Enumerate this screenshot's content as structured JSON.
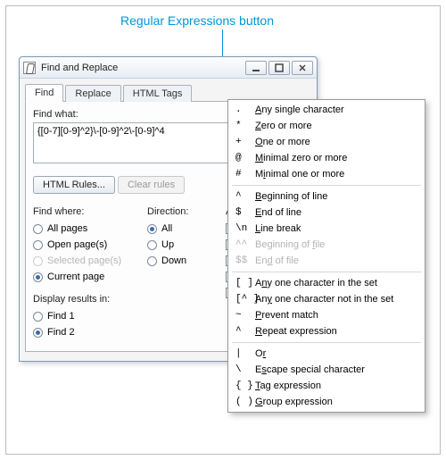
{
  "annotation": "Regular Expressions button",
  "window": {
    "title": "Find and Replace",
    "tabs": [
      "Find",
      "Replace",
      "HTML Tags"
    ],
    "find_label": "Find what:",
    "find_value": "{[0-7][0-9]^2}\\-[0-9]^2\\-[0-9]^4",
    "html_rules_btn": "HTML Rules...",
    "clear_rules_btn": "Clear rules",
    "find_where_label": "Find where:",
    "find_where": {
      "all_pages": "All pages",
      "open_pages": "Open page(s)",
      "selected_pages": "Selected page(s)",
      "current_page": "Current page"
    },
    "direction_label": "Direction:",
    "direction": {
      "all": "All",
      "up": "Up",
      "down": "Down"
    },
    "advanced_label": "Adv",
    "display_label": "Display results in:",
    "display": {
      "find1": "Find 1",
      "find2": "Find 2"
    }
  },
  "menu": {
    "items": [
      {
        "sym": ".",
        "pre": "",
        "u": "A",
        "post": "ny single character"
      },
      {
        "sym": "*",
        "pre": "",
        "u": "Z",
        "post": "ero or more"
      },
      {
        "sym": "+",
        "pre": "",
        "u": "O",
        "post": "ne or more"
      },
      {
        "sym": "@",
        "pre": "",
        "u": "M",
        "post": "inimal zero or more"
      },
      {
        "sym": "#",
        "pre": "M",
        "u": "i",
        "post": "nimal one or more"
      },
      {
        "sep": true
      },
      {
        "sym": "^",
        "pre": "",
        "u": "B",
        "post": "eginning of line"
      },
      {
        "sym": "$",
        "pre": "",
        "u": "E",
        "post": "nd of line"
      },
      {
        "sym": "\\n",
        "pre": "",
        "u": "L",
        "post": "ine break"
      },
      {
        "sym": "^^",
        "pre": "Beginning of ",
        "u": "f",
        "post": "ile",
        "disabled": true
      },
      {
        "sym": "$$",
        "pre": "En",
        "u": "d",
        "post": " of file",
        "disabled": true
      },
      {
        "sep": true
      },
      {
        "sym": "[ ]",
        "pre": "A",
        "u": "n",
        "post": "y one character in the set"
      },
      {
        "sym": "[^ ]",
        "pre": "An",
        "u": "y",
        "post": " one character not in the set"
      },
      {
        "sym": "~",
        "pre": "",
        "u": "P",
        "post": "revent match"
      },
      {
        "sym": "^",
        "pre": "",
        "u": "R",
        "post": "epeat expression"
      },
      {
        "sep": true
      },
      {
        "sym": "|",
        "pre": "O",
        "u": "r",
        "post": ""
      },
      {
        "sym": "\\",
        "pre": "E",
        "u": "s",
        "post": "cape special character"
      },
      {
        "sym": "{ }",
        "pre": "",
        "u": "T",
        "post": "ag expression"
      },
      {
        "sym": "( )",
        "pre": "",
        "u": "G",
        "post": "roup expression"
      }
    ]
  }
}
